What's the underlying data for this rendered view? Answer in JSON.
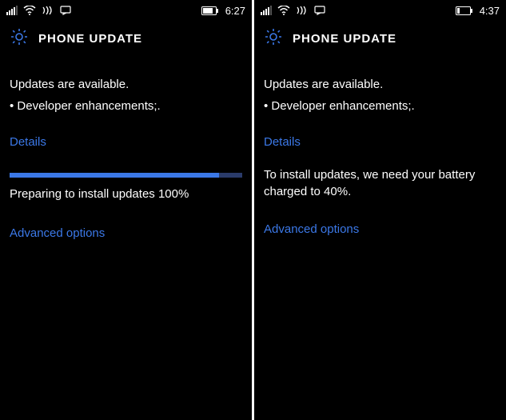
{
  "left": {
    "time": "6:27",
    "title": "PHONE UPDATE",
    "intro": "Updates are available.",
    "bullet": "• Developer enhancements;.",
    "details_link": "Details",
    "progress_pct": 90,
    "status_text": "Preparing to install updates 100%",
    "advanced_link": "Advanced options"
  },
  "right": {
    "time": "4:37",
    "title": "PHONE UPDATE",
    "intro": "Updates are available.",
    "bullet": "• Developer enhancements;.",
    "details_link": "Details",
    "body_text": "To install updates, we need your battery charged to 40%.",
    "advanced_link": "Advanced options"
  }
}
